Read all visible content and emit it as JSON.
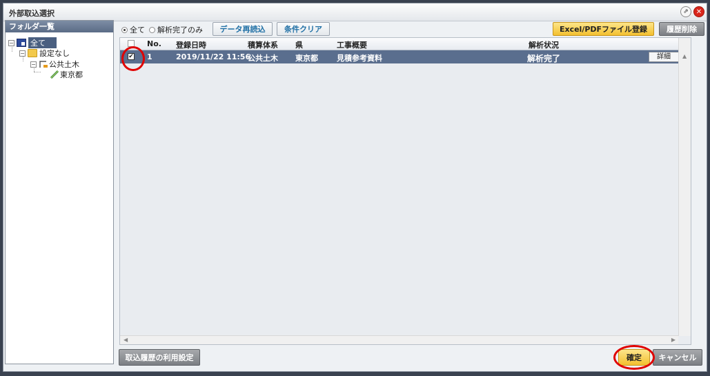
{
  "window": {
    "title": "外部取込選択"
  },
  "folder_panel": {
    "header": "フォルダ一覧",
    "tree": [
      {
        "label": "全て",
        "selected": true
      },
      {
        "label": "設定なし"
      },
      {
        "label": "公共土木"
      },
      {
        "label": "東京都"
      }
    ]
  },
  "toolbar": {
    "radio_all": "全て",
    "radio_done": "解析完了のみ",
    "reload": "データ再読込",
    "clear": "条件クリア",
    "register": "Excel/PDFファイル登録",
    "delete_history": "履歴削除"
  },
  "table": {
    "columns": [
      "No.",
      "登録日時",
      "積算体系",
      "県",
      "工事概要",
      "解析状況"
    ],
    "rows": [
      {
        "checked": true,
        "no": "1",
        "datetime": "2019/11/22 11:56",
        "system": "公共土木",
        "pref": "東京都",
        "summary": "見積参考資料",
        "status": "解析完了",
        "detail": "詳細"
      }
    ]
  },
  "footer": {
    "history_settings": "取込履歴の利用設定",
    "confirm": "確定",
    "cancel": "キャンセル"
  },
  "colors": {
    "highlight_red": "#e00000",
    "selected_row": "#5a6e8e",
    "confirm_yellow": "#f3c030"
  }
}
